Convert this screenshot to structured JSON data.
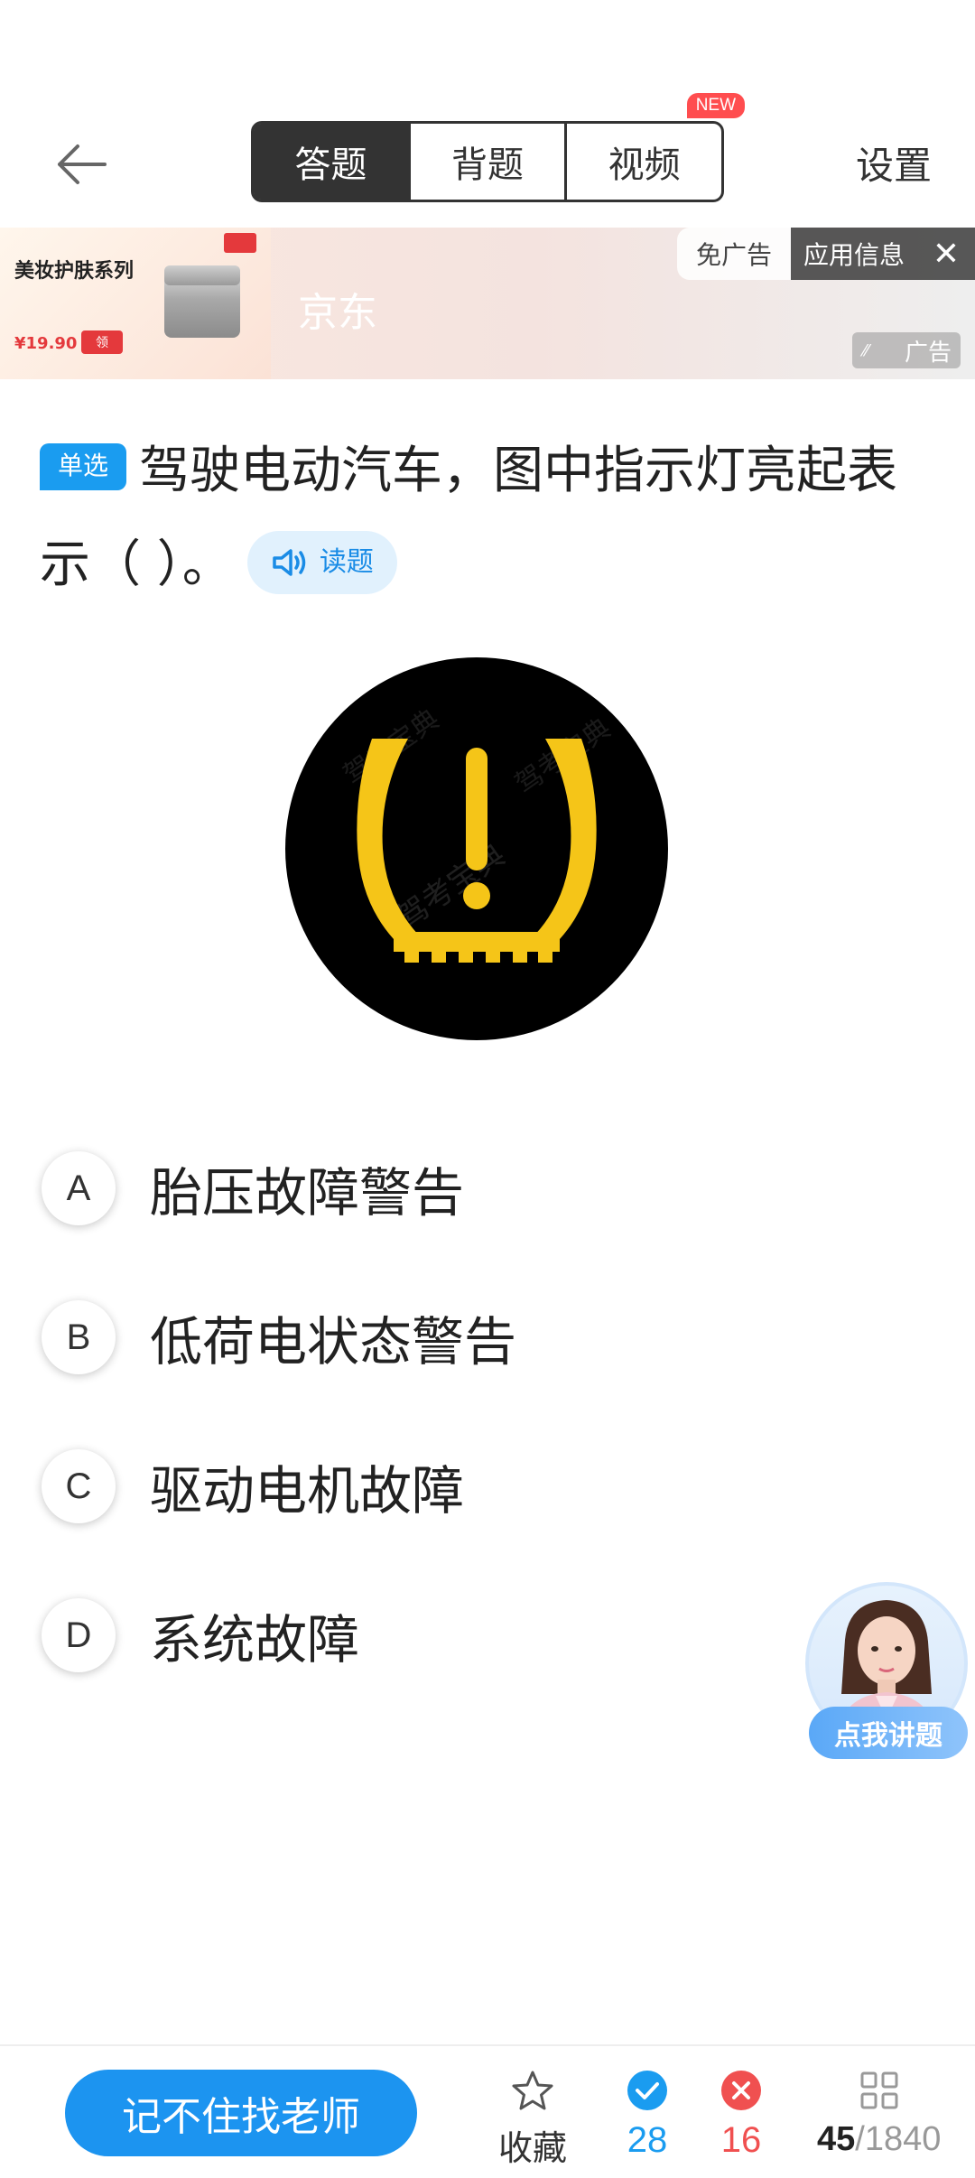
{
  "header": {
    "tabs": [
      {
        "label": "答题",
        "active": true
      },
      {
        "label": "背题",
        "active": false
      },
      {
        "label": "视频",
        "active": false,
        "badge": "NEW"
      }
    ],
    "settings_label": "设置"
  },
  "ad": {
    "product_title": "美妆护肤系列",
    "brand": "京东",
    "price": "¥19.90",
    "buy_label": "领",
    "no_ad_label": "免广告",
    "app_info_label": "应用信息",
    "close_icon": "✕",
    "ad_label": "广告"
  },
  "question": {
    "type": "单选",
    "text": "驾驶电动汽车，图中指示灯亮起表示（    ）。",
    "read_label": "读题",
    "image": "tire-pressure-warning-light",
    "image_watermark": "驾考宝典"
  },
  "options": [
    {
      "letter": "A",
      "text": "胎压故障警告"
    },
    {
      "letter": "B",
      "text": "低荷电状态警告"
    },
    {
      "letter": "C",
      "text": "驱动电机故障"
    },
    {
      "letter": "D",
      "text": "系统故障"
    }
  ],
  "float_teacher": {
    "label": "点我讲题"
  },
  "bottom": {
    "ask_teacher_label": "记不住找老师",
    "favorite_label": "收藏",
    "correct_count": "28",
    "wrong_count": "16",
    "current": "45",
    "total": "/1840"
  },
  "colors": {
    "accent": "#1c94f0",
    "wrong": "#f05050",
    "warning_yellow": "#f5c518"
  }
}
